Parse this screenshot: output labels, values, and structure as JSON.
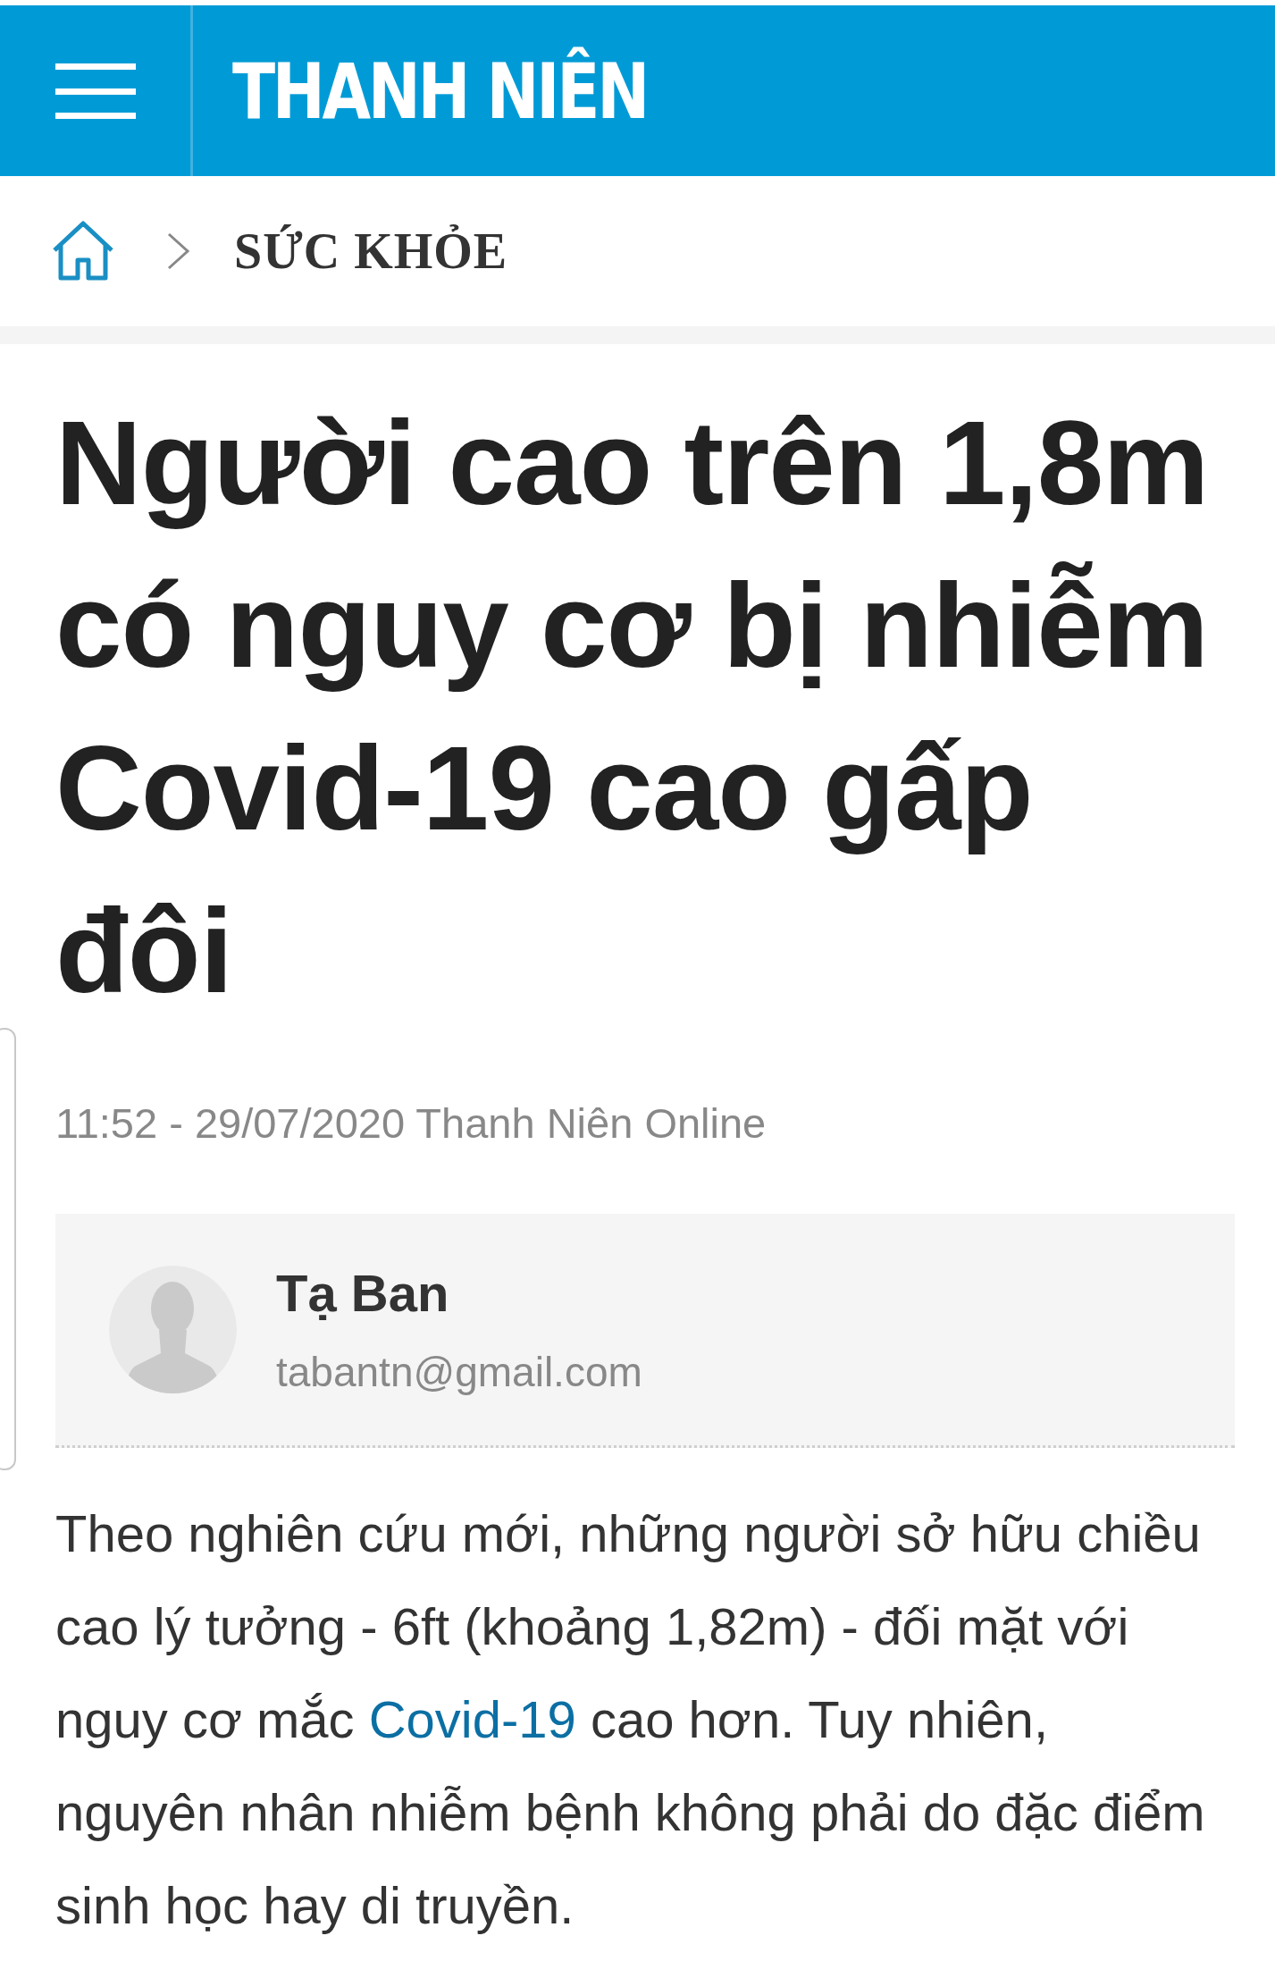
{
  "header": {
    "logo": "THANH NIÊN"
  },
  "breadcrumb": {
    "section": "SỨC KHỎE"
  },
  "article": {
    "title": "Người cao trên 1,8m có nguy cơ bị nhiễm Covid-19 cao gấp đôi",
    "meta": "11:52 - 29/07/2020 Thanh Niên Online",
    "author": {
      "name": "Tạ Ban",
      "email": "tabantn@gmail.com"
    },
    "body": [
      {
        "kind": "text",
        "text": "Theo nghiên cứu mới, những người sở hữu chiều cao lý tưởng - 6ft (khoảng 1,82m) - đối mặt với nguy cơ mắc "
      },
      {
        "kind": "link",
        "text": "Covid-19"
      },
      {
        "kind": "text",
        "text": " cao hơn. Tuy nhiên, nguyên nhân nhiễm bệnh không phải do đặc điểm sinh học hay di truyền."
      }
    ]
  }
}
